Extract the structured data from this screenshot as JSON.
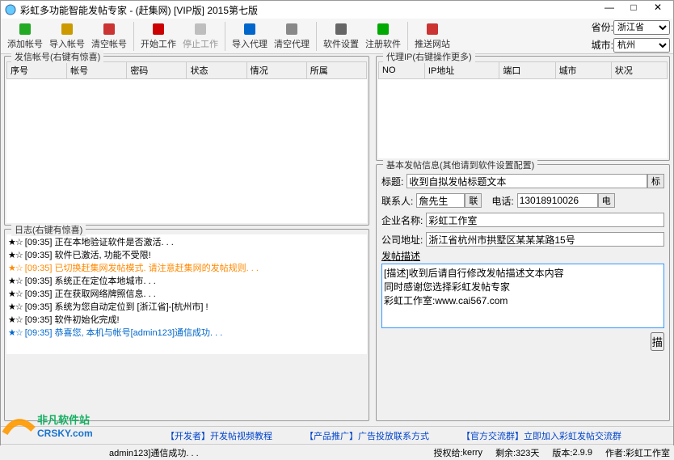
{
  "title": "彩虹多功能智能发帖专家 - (赶集网)   [VIP版]   2015第七版",
  "win": {
    "min": "—",
    "max": "□",
    "close": "✕"
  },
  "toolbar": [
    {
      "k": "add",
      "label": "添加帐号",
      "ic": "plus",
      "int": true
    },
    {
      "k": "import",
      "label": "导入帐号",
      "ic": "folder",
      "int": true
    },
    {
      "k": "clear",
      "label": "清空帐号",
      "ic": "trash",
      "int": true
    },
    {
      "sep": true
    },
    {
      "k": "start",
      "label": "开始工作",
      "ic": "play",
      "int": true
    },
    {
      "k": "stop",
      "label": "停止工作",
      "ic": "stop",
      "int": false
    },
    {
      "sep": true
    },
    {
      "k": "proxy",
      "label": "导入代理",
      "ic": "download",
      "int": true
    },
    {
      "k": "clearproxy",
      "label": "清空代理",
      "ic": "trashb",
      "int": true
    },
    {
      "sep": true
    },
    {
      "k": "settings",
      "label": "软件设置",
      "ic": "gear",
      "int": true
    },
    {
      "k": "register",
      "label": "注册软件",
      "ic": "reg",
      "int": true
    },
    {
      "sep": true
    },
    {
      "k": "push",
      "label": "推送网站",
      "ic": "push",
      "int": true
    }
  ],
  "region": {
    "prov_label": "省份:",
    "prov": "浙江省",
    "city_label": "城市:",
    "city": "杭州"
  },
  "left": {
    "acct_title": "发信帐号(右键有惊喜)",
    "acct_cols": [
      "序号",
      "帐号",
      "密码",
      "状态",
      "情况",
      "所属"
    ],
    "log_title": "日志(右键有惊喜)",
    "logs": [
      {
        "s": "★☆",
        "c": "",
        "t": "[09:35] 正在本地验证软件是否激活. . ."
      },
      {
        "s": "★☆",
        "c": "",
        "t": "[09:35] 软件已激活, 功能不受限!"
      },
      {
        "s": "★☆",
        "c": "orange",
        "t": "[09:35] 已切换赶集网发帖模式. 请注意赶集网的发帖规则. . ."
      },
      {
        "s": "★☆",
        "c": "",
        "t": "[09:35] 系统正在定位本地城市. . ."
      },
      {
        "s": "★☆",
        "c": "",
        "t": "[09:35] 正在获取网络牌照信息. . ."
      },
      {
        "s": "★☆",
        "c": "",
        "t": "[09:35] 系统为您自动定位到 [浙江省]-[杭州市] !"
      },
      {
        "s": "★☆",
        "c": "",
        "t": "[09:35] 软件初始化完成!"
      },
      {
        "s": "★☆",
        "c": "blue",
        "t": "[09:35] 恭喜您, 本机与帐号[admin123]通信成功. . ."
      }
    ]
  },
  "right": {
    "proxy_title": "代理IP(右键操作更多)",
    "proxy_cols": [
      "NO",
      "IP地址",
      "端口",
      "城市",
      "状况"
    ],
    "post_title": "基本发帖信息(其他请到软件设置配置)",
    "f_title_label": "标题:",
    "f_title": "收到自拟发帖标题文本",
    "f_title_btn": "标",
    "f_contact_label": "联系人:",
    "f_contact": "詹先生",
    "f_contact_btn": "联",
    "f_tel_label": "电话:",
    "f_tel": "13018910026",
    "f_tel_btn": "电",
    "f_company_label": "企业名称:",
    "f_company": "彩虹工作室",
    "f_addr_label": "公司地址:",
    "f_addr": "浙江省杭州市拱墅区某某某路15号",
    "desc_label": "发帖描述",
    "desc": "[描述]收到后请自行修改发帖描述文本内容\n同时感谢您选择彩虹发帖专家\n彩虹工作室:www.cai567.com",
    "desc_btn": "描"
  },
  "footer": {
    "l1_pre": "【开发者】",
    "l1": "开发帖视频教程",
    "l2_pre": "【产品推广】",
    "l2": "广告投放联系方式",
    "l3_pre": "【官方交流群】",
    "l3": "立即加入彩虹发帖交流群"
  },
  "status": {
    "comm": "admin123]通信成功. . .",
    "auth_label": "授权给:",
    "auth": "kerry",
    "days_label": "剩余:",
    "days": "323天",
    "ver_label": "版本:",
    "ver": "2.9.9",
    "author_label": "作者:",
    "author": "彩虹工作室"
  },
  "watermark": {
    "line1": "非凡软件站",
    "line2": "CRSKY.com"
  }
}
